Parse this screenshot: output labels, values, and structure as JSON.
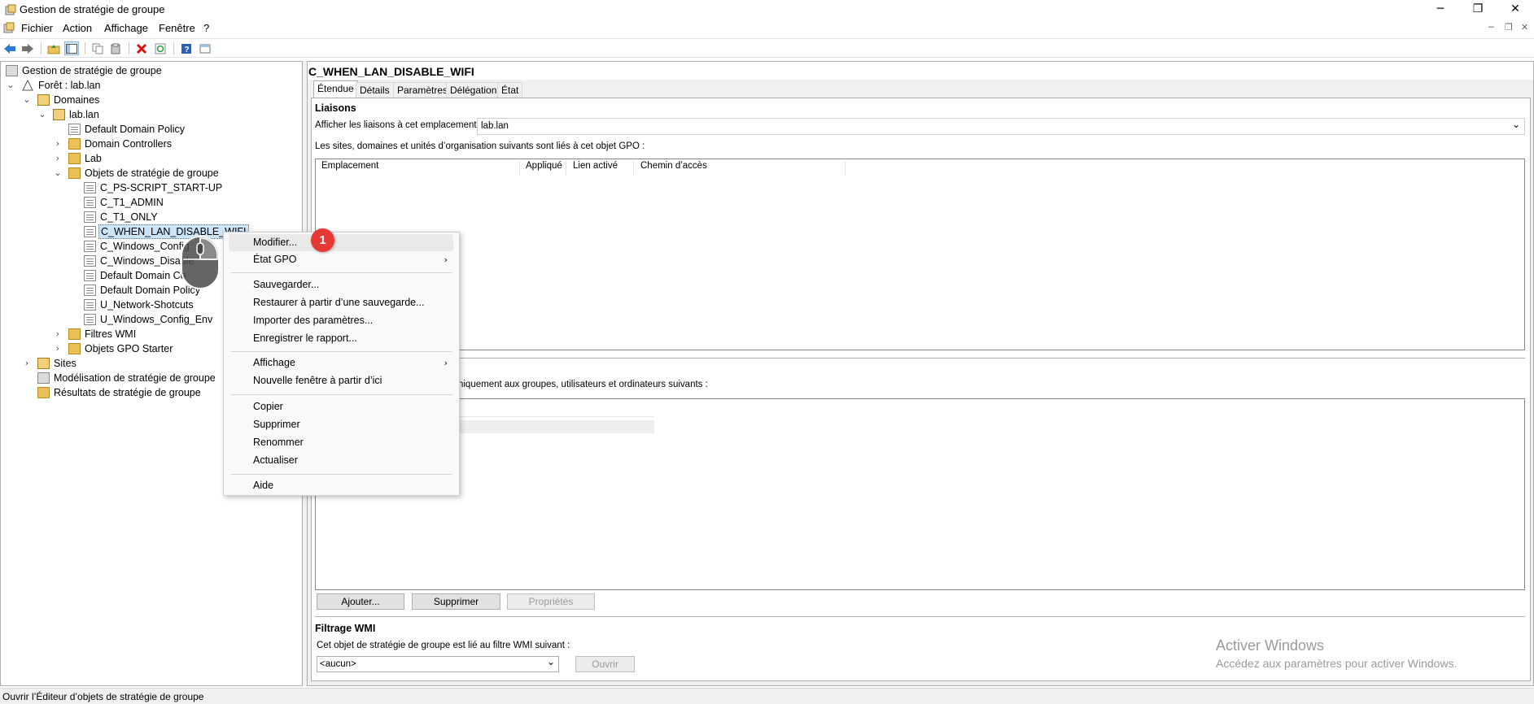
{
  "window": {
    "title": "Gestion de stratégie de groupe",
    "minimize": "─",
    "maximize": "❐",
    "close": "✕"
  },
  "menubar": {
    "items": [
      "Fichier",
      "Action",
      "Affichage",
      "Fenêtre",
      "?"
    ],
    "mdi_minimize": "─",
    "mdi_restore": "❐",
    "mdi_close": "✕"
  },
  "toolbar": {
    "icons": [
      "back-arrow-icon",
      "forward-arrow-icon",
      "up-folder-icon",
      "show-hide-tree-icon",
      "copy-icon",
      "paste-icon",
      "delete-icon",
      "refresh-icon",
      "help-icon",
      "properties-icon"
    ]
  },
  "tree": {
    "root": "Gestion de stratégie de groupe",
    "forest": "Forêt : lab.lan",
    "domains": "Domaines",
    "domain": "lab.lan",
    "default_domain_policy": "Default Domain Policy",
    "domain_controllers": "Domain Controllers",
    "lab": "Lab",
    "gpo_container": "Objets de stratégie de groupe",
    "gpos": [
      "C_PS-SCRIPT_START-UP",
      "C_T1_ADMIN",
      "C_T1_ONLY",
      "C_WHEN_LAN_DISABLE_WIFI",
      "C_Windows_Config",
      "C_Windows_Disable",
      "Default Domain Co",
      "Default Domain Policy",
      "U_Network-Shotcuts",
      "U_Windows_Config_Env"
    ],
    "wmi_filters": "Filtres WMI",
    "starter_gpos": "Objets GPO Starter",
    "sites": "Sites",
    "modeling": "Modélisation de stratégie de groupe",
    "results": "Résultats de stratégie de groupe",
    "expander_open": "⌄",
    "expander_closed": "›"
  },
  "right": {
    "title": "C_WHEN_LAN_DISABLE_WIFI",
    "tabs": [
      "Étendue",
      "Détails",
      "Paramètres",
      "Délégation",
      "État"
    ],
    "links_section": "Liaisons",
    "links_location_label": "Afficher les liaisons à cet emplacement :",
    "links_location_value": "lab.lan",
    "links_desc": "Les sites, domaines et unités d’organisation suivants sont liés à cet objet GPO :",
    "links_columns": [
      "Emplacement",
      "Appliqué",
      "Lien activé",
      "Chemin d’accès"
    ],
    "security_desc_tail": "uent uniquement aux groupes, utilisateurs et ordinateurs suivants :",
    "btn_add": "Ajouter...",
    "btn_remove": "Supprimer",
    "btn_properties": "Propriétés",
    "wmi_section": "Filtrage WMI",
    "wmi_desc": "Cet objet de stratégie de groupe est lié au filtre WMI suivant :",
    "wmi_value": "<aucun>",
    "wmi_open": "Ouvrir",
    "dropdown_arrow": "⌄"
  },
  "watermark": {
    "line1": "Activer Windows",
    "line2": "Accédez aux paramètres pour activer Windows."
  },
  "context_menu": {
    "items": [
      {
        "label": "Modifier...",
        "submenu": false
      },
      {
        "label": "État GPO",
        "submenu": true
      },
      {
        "label": "Sauvegarder...",
        "submenu": false
      },
      {
        "label": "Restaurer à partir d’une sauvegarde...",
        "submenu": false
      },
      {
        "label": "Importer des paramètres...",
        "submenu": false
      },
      {
        "label": "Enregistrer le rapport...",
        "submenu": false
      },
      {
        "label": "Affichage",
        "submenu": true
      },
      {
        "label": "Nouvelle fenêtre à partir d’ici",
        "submenu": false
      },
      {
        "label": "Copier",
        "submenu": false
      },
      {
        "label": "Supprimer",
        "submenu": false
      },
      {
        "label": "Renommer",
        "submenu": false
      },
      {
        "label": "Actualiser",
        "submenu": false
      },
      {
        "label": "Aide",
        "submenu": false
      }
    ],
    "submenu_arrow": "›"
  },
  "annotation": {
    "step": "1"
  },
  "statusbar": {
    "text": "Ouvrir l’Éditeur d’objets de stratégie de groupe"
  }
}
